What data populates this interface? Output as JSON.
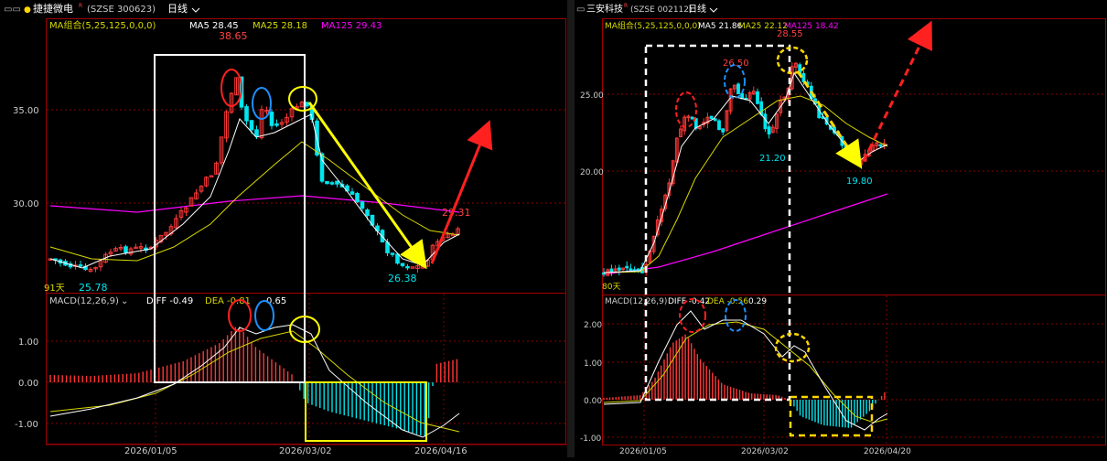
{
  "panels": [
    {
      "id": "left",
      "header": {
        "bullet": "●",
        "name": "捷捷微电",
        "mark": "R",
        "code": "(SZSE 300623)",
        "period": "日线",
        "chevron": "chevron-down"
      },
      "ma_legend": {
        "label": "MA组合(5,25,125,0,0,0)",
        "ma5": "MA5 28.45",
        "ma25": "MA25 28.18",
        "ma125": "MA125 29.43"
      },
      "macd_legend": {
        "label": "MACD(12,26,9)",
        "diff": "DIFF -0.49",
        "dea": "DEA -0.81",
        "macd": "0.65"
      },
      "price_axis": [
        "35.00",
        "30.00"
      ],
      "macd_axis": [
        "1.00",
        "0.00",
        "-1.00"
      ],
      "date_axis": [
        "2026/01/05",
        "2026/03/02",
        "2026/04/16"
      ],
      "annotations": {
        "high": "38.65",
        "low_left": "25.78",
        "low_right": "26.38",
        "last": "29.31",
        "days": "91天"
      },
      "colors": {
        "ma5": "#ffffff",
        "ma25": "#d8d800",
        "ma125": "#ff00ff",
        "up": "#ff3838",
        "down": "#00e5ee"
      }
    },
    {
      "id": "right",
      "header": {
        "bullet": "●",
        "name": "三安科技",
        "mark": "R",
        "code": "(SZSE 002112)",
        "period": "日线",
        "chevron": "chevron-down"
      },
      "ma_legend": {
        "label": "MA组合(5,25,125,0,0,0)",
        "ma5": "MA5 21.86",
        "ma25": "MA25 22.12",
        "ma125": "MA125 18.42"
      },
      "macd_legend": {
        "label": "MACD(12,26,9)",
        "diff": "DIFF -0.42",
        "dea": "DEA -0.56",
        "macd": "0.29"
      },
      "price_axis": [
        "25.00",
        "20.00"
      ],
      "macd_axis": [
        "2.00",
        "1.00",
        "0.00",
        "-1.00"
      ],
      "date_axis": [
        "2026/01/05",
        "2026/03/02",
        "2026/04/20"
      ],
      "annotations": {
        "high": "28.55",
        "mid_high": "26.50",
        "low_mid": "21.20",
        "low_right": "19.80",
        "days": "80天"
      },
      "colors": {
        "ma5": "#ffffff",
        "ma25": "#d8d800",
        "ma125": "#ff00ff",
        "up": "#ff3838",
        "down": "#00e5ee"
      }
    }
  ]
}
